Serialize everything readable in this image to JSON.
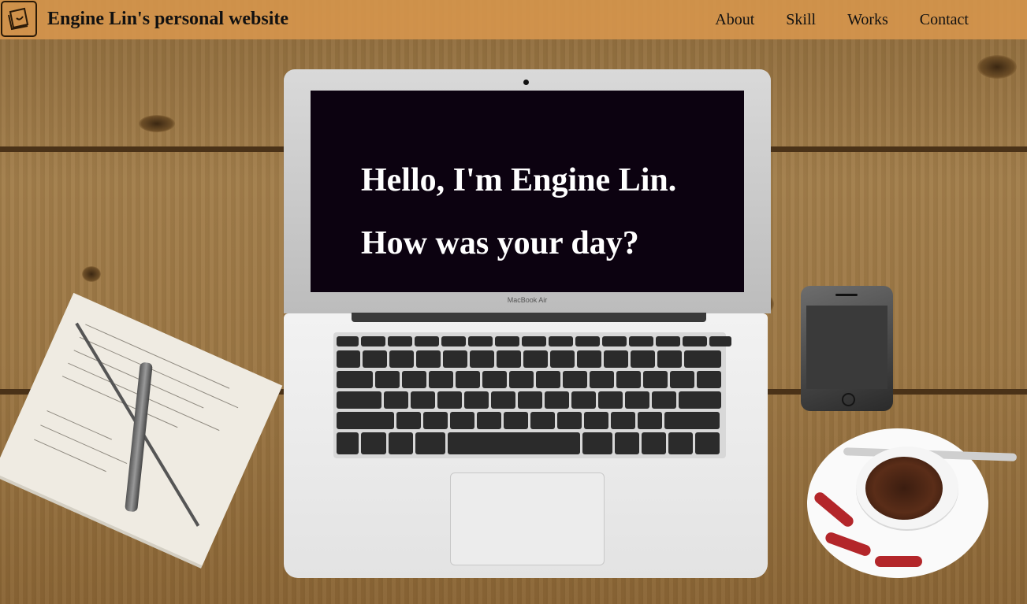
{
  "nav": {
    "logo_icon": "notebook-logo-icon",
    "title": "Engine Lin's personal website",
    "links": [
      "About",
      "Skill",
      "Works",
      "Contact"
    ]
  },
  "hero": {
    "line1": "Hello, I'm Engine Lin.",
    "line2": "How was your day?"
  },
  "laptop": {
    "brand": "MacBook Air"
  },
  "colors": {
    "navbar": "#d6964c",
    "screen": "#0c0210",
    "hero_text": "#ffffff"
  }
}
